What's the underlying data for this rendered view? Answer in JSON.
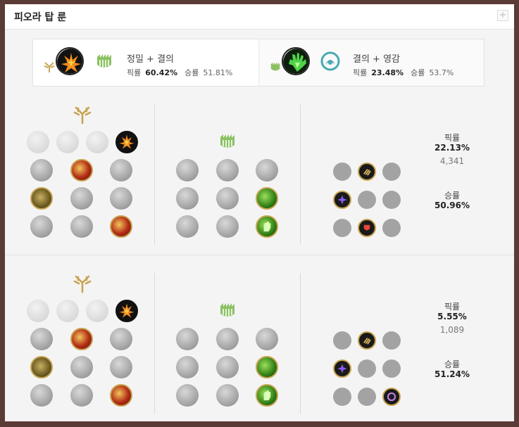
{
  "header": {
    "title": "피오라 탑 룬",
    "plus_label": "+"
  },
  "summary": [
    {
      "name": "정밀 + 결의",
      "pick_label": "픽률",
      "pick_value": "60.42%",
      "win_label": "승률",
      "win_value": "51.81%",
      "keystone_icon": "conqueror-icon",
      "secondary_icon": "resolve-tree-icon"
    },
    {
      "name": "결의 + 영감",
      "pick_label": "픽률",
      "pick_value": "23.48%",
      "win_label": "승률",
      "win_value": "53.7%",
      "keystone_icon": "grasp-of-the-undying-icon",
      "secondary_icon": "inspiration-tree-icon"
    }
  ],
  "builds": [
    {
      "pick_label": "픽률",
      "pick_value": "22.13%",
      "count": "4,341",
      "win_label": "승률",
      "win_value": "50.96%"
    },
    {
      "pick_label": "픽률",
      "pick_value": "5.55%",
      "count": "1,089",
      "win_label": "승률",
      "win_value": "51.24%"
    }
  ],
  "colors": {
    "precision_gold": "#c8a451",
    "resolve_green": "#7fb24a",
    "inspiration_teal": "#49a9b3",
    "background": "#f4f4f4",
    "border": "#5b3b36"
  }
}
